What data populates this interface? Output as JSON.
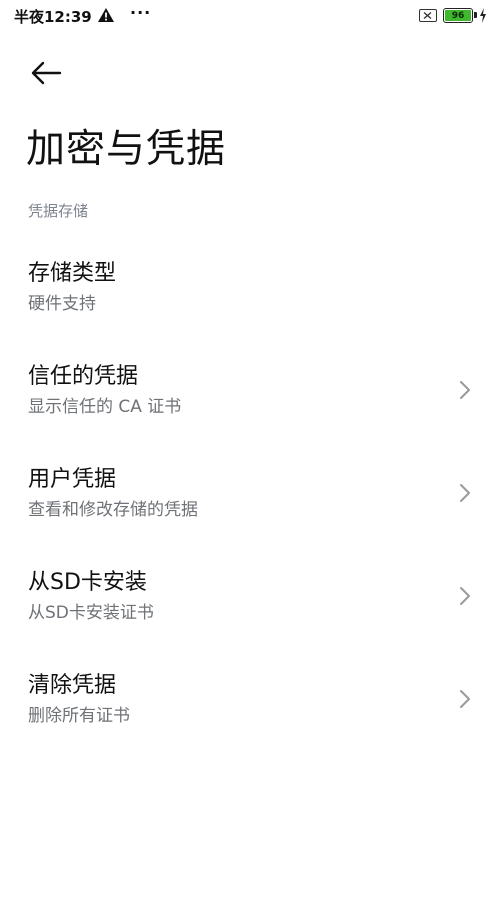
{
  "status_bar": {
    "time": "半夜12:39",
    "more": "···",
    "battery_level": "96",
    "battery_color": "#3fb82e"
  },
  "page": {
    "title": "加密与凭据",
    "section_header": "凭据存储"
  },
  "items": [
    {
      "title": "存储类型",
      "subtitle": "硬件支持",
      "has_chevron": false
    },
    {
      "title": "信任的凭据",
      "subtitle": "显示信任的 CA 证书",
      "has_chevron": true
    },
    {
      "title": "用户凭据",
      "subtitle": "查看和修改存储的凭据",
      "has_chevron": true
    },
    {
      "title": "从SD卡安装",
      "subtitle": "从SD卡安装证书",
      "has_chevron": true
    },
    {
      "title": "清除凭据",
      "subtitle": "删除所有证书",
      "has_chevron": true
    }
  ],
  "icons": {
    "back": "arrow-left-icon",
    "chevron": "chevron-right-icon",
    "warning": "warning-icon",
    "sim": "no-sim-icon",
    "battery": "battery-icon",
    "charge": "charging-icon"
  }
}
